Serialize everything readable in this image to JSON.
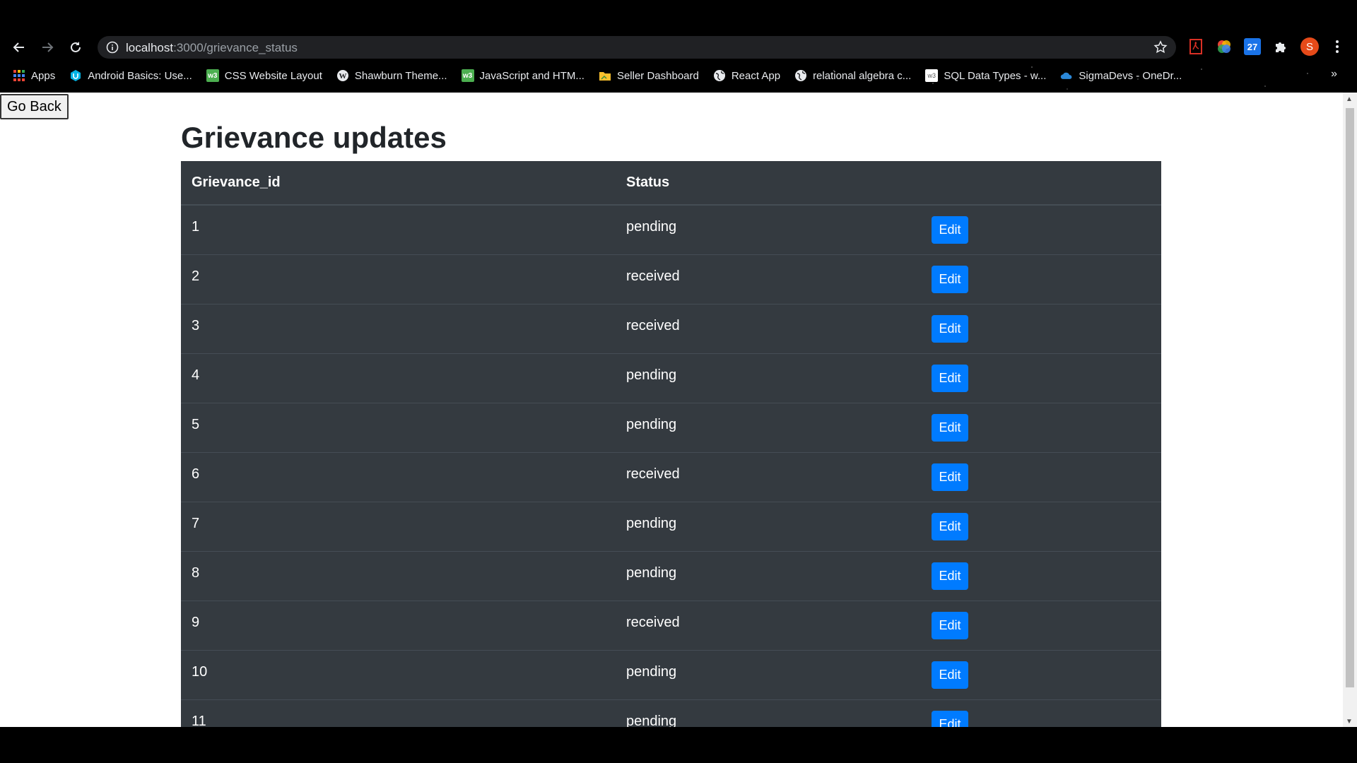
{
  "browser": {
    "url_host": "localhost",
    "url_path": ":3000/grievance_status",
    "profile_initial": "S",
    "extension_badge": "27"
  },
  "bookmarks": [
    {
      "label": "Apps",
      "icon": "apps-grid-icon"
    },
    {
      "label": "Android Basics: Use...",
      "icon": "udacity-icon"
    },
    {
      "label": "CSS Website Layout",
      "icon": "w3-icon"
    },
    {
      "label": "Shawburn Theme...",
      "icon": "wordpress-icon"
    },
    {
      "label": "JavaScript and HTM...",
      "icon": "w3-icon"
    },
    {
      "label": "Seller Dashboard",
      "icon": "folder-icon"
    },
    {
      "label": "React App",
      "icon": "globe-icon"
    },
    {
      "label": "relational algebra c...",
      "icon": "globe-icon"
    },
    {
      "label": "SQL Data Types - w...",
      "icon": "w3schools-icon"
    },
    {
      "label": "SigmaDevs - OneDr...",
      "icon": "onedrive-icon"
    }
  ],
  "page": {
    "go_back_label": "Go Back",
    "title": "Grievance updates"
  },
  "table": {
    "headers": [
      "Grievance_id",
      "Status",
      ""
    ],
    "edit_label": "Edit",
    "rows": [
      {
        "id": "1",
        "status": "pending"
      },
      {
        "id": "2",
        "status": "received"
      },
      {
        "id": "3",
        "status": "received"
      },
      {
        "id": "4",
        "status": "pending"
      },
      {
        "id": "5",
        "status": "pending"
      },
      {
        "id": "6",
        "status": "received"
      },
      {
        "id": "7",
        "status": "pending"
      },
      {
        "id": "8",
        "status": "pending"
      },
      {
        "id": "9",
        "status": "received"
      },
      {
        "id": "10",
        "status": "pending"
      },
      {
        "id": "11",
        "status": "pending"
      }
    ]
  },
  "colors": {
    "table_bg": "#343a40",
    "edit_button": "#007bff",
    "title_text": "#212529"
  }
}
